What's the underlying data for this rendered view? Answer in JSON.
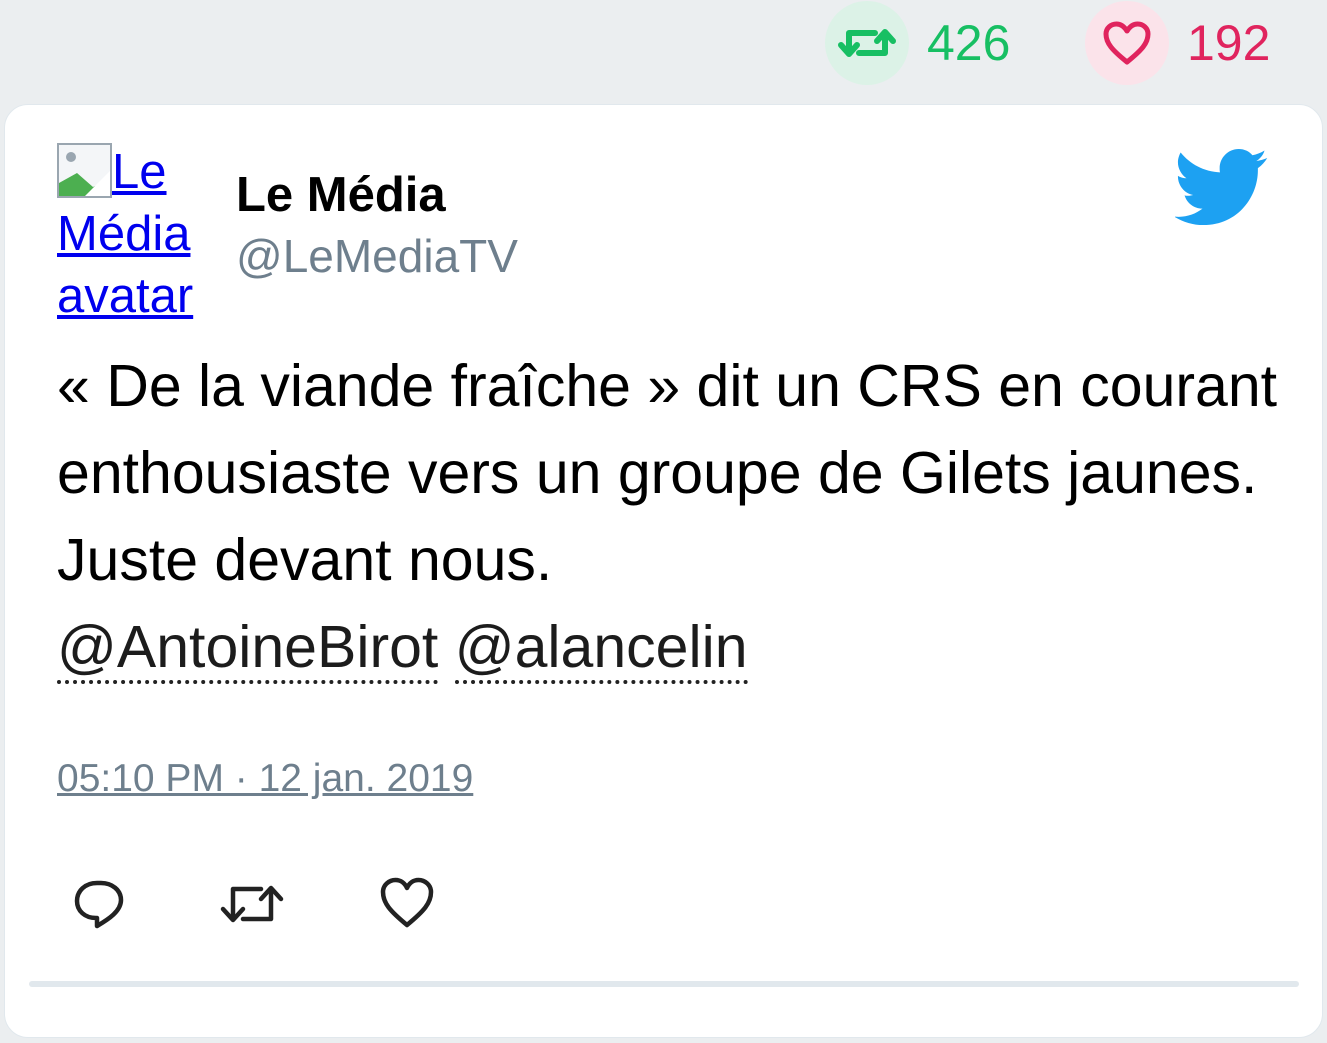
{
  "stats": {
    "retweets": "426",
    "likes": "192"
  },
  "author": {
    "avatar_alt": "Le Média avatar",
    "name": "Le Média",
    "handle": "@LeMediaTV"
  },
  "tweet": {
    "text": "« De la viande fraîche » dit un CRS en courant enthousiaste vers un groupe de Gilets jaunes. Juste devant nous.",
    "mentions": [
      "@AntoineBirot",
      "@alancelin"
    ],
    "timestamp": "05:10 PM · 12 jan. 2019"
  },
  "icons": {
    "retweet": "retweet-icon",
    "like": "heart-icon",
    "reply": "reply-icon",
    "brand": "twitter-bird-icon"
  },
  "colors": {
    "retweet": "#17bf63",
    "like": "#e0245e",
    "brand": "#1da1f2",
    "muted": "#6e7f8d"
  }
}
